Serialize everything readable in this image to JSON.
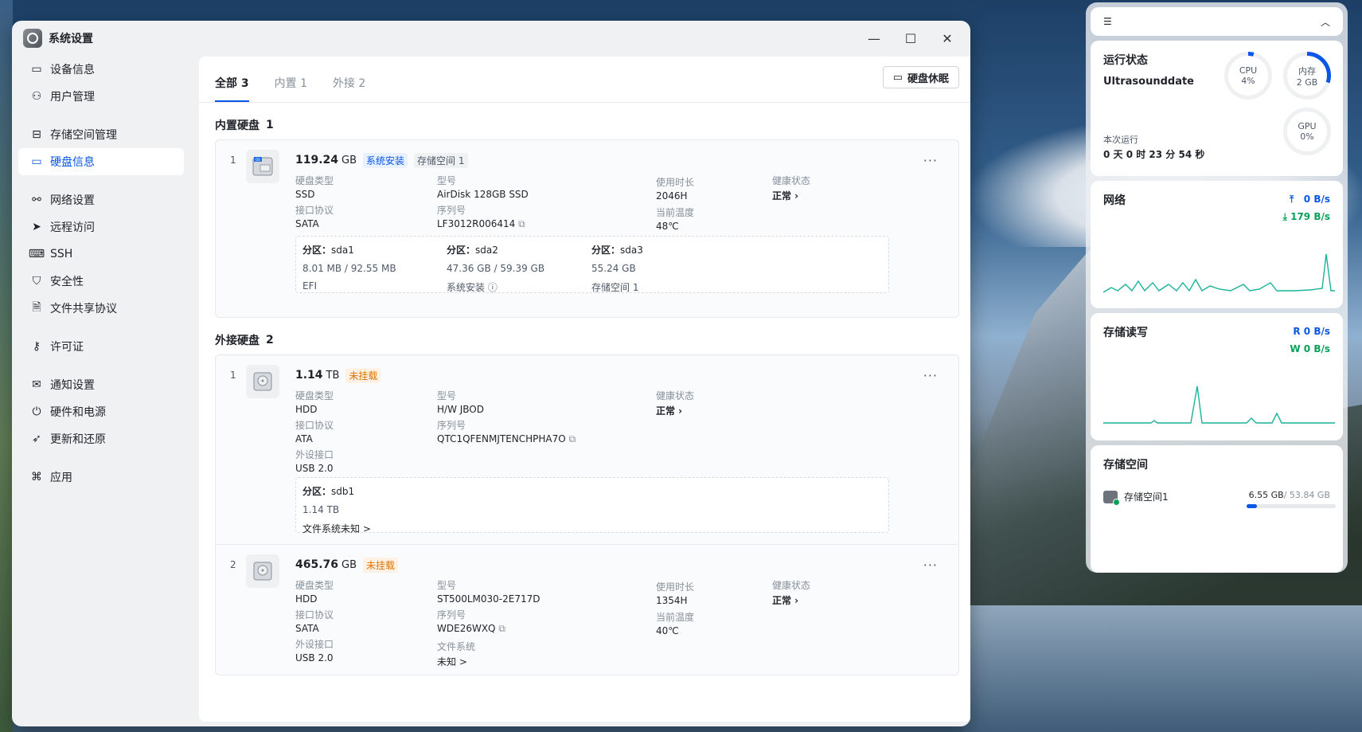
{
  "window": {
    "title": "系统设置"
  },
  "sidebar": {
    "items": [
      {
        "label": "设备信息",
        "icon": "device-icon"
      },
      {
        "label": "用户管理",
        "icon": "user-icon"
      },
      {
        "label": "存储空间管理",
        "icon": "storage-icon"
      },
      {
        "label": "硬盘信息",
        "icon": "disk-icon"
      },
      {
        "label": "网络设置",
        "icon": "network-icon"
      },
      {
        "label": "远程访问",
        "icon": "send-icon"
      },
      {
        "label": "SSH",
        "icon": "terminal-icon"
      },
      {
        "label": "安全性",
        "icon": "shield-icon"
      },
      {
        "label": "文件共享协议",
        "icon": "file-icon"
      },
      {
        "label": "许可证",
        "icon": "key-icon"
      },
      {
        "label": "通知设置",
        "icon": "mail-icon"
      },
      {
        "label": "硬件和电源",
        "icon": "power-icon"
      },
      {
        "label": "更新和还原",
        "icon": "rocket-icon"
      },
      {
        "label": "应用",
        "icon": "apps-icon"
      }
    ]
  },
  "tabs": [
    {
      "label": "全部 3"
    },
    {
      "label": "内置 1"
    },
    {
      "label": "外接 2"
    }
  ],
  "sleep_button": "硬盘休眠",
  "internal": {
    "title": "内置硬盘",
    "count": "1",
    "disk1": {
      "index": "1",
      "size": "119.24",
      "unit": "GB",
      "tag1": "系统安装",
      "tag2": "存储空间 1",
      "type_l": "硬盘类型",
      "type_v": "SSD",
      "model_l": "型号",
      "model_v": "AirDisk 128GB SSD",
      "uptime_l": "使用时长",
      "uptime_v": "2046H",
      "health_l": "健康状态",
      "health_v": "正常 ›",
      "proto_l": "接口协议",
      "proto_v": "SATA",
      "serial_l": "序列号",
      "serial_v": "LF3012R006414",
      "temp_l": "当前温度",
      "temp_v": "48℃",
      "parts": [
        {
          "name": "分区：",
          "id": "sda1",
          "size": "8.01 MB / 92.55 MB",
          "fs": "EFI"
        },
        {
          "name": "分区：",
          "id": "sda2",
          "size": "47.36 GB / 59.39 GB",
          "fs": "系统安装"
        },
        {
          "name": "分区：",
          "id": "sda3",
          "size": "55.24 GB",
          "fs": "存储空间 1"
        }
      ]
    }
  },
  "external": {
    "title": "外接硬盘",
    "count": "2",
    "disk1": {
      "index": "1",
      "size": "1.14",
      "unit": "TB",
      "tag": "未挂载",
      "type_l": "硬盘类型",
      "type_v": "HDD",
      "model_l": "型号",
      "model_v": "H/W JBOD",
      "health_l": "健康状态",
      "health_v": "正常 ›",
      "proto_l": "接口协议",
      "proto_v": "ATA",
      "serial_l": "序列号",
      "serial_v": "QTC1QFENMJTENCHPHA7O",
      "port_l": "外设接口",
      "port_v": "USB 2.0",
      "part": {
        "name": "分区：",
        "id": "sdb1",
        "size": "1.14 TB",
        "fs": "文件系统未知 >"
      }
    },
    "disk2": {
      "index": "2",
      "size": "465.76",
      "unit": "GB",
      "tag": "未挂载",
      "type_l": "硬盘类型",
      "type_v": "HDD",
      "model_l": "型号",
      "model_v": "ST500LM030-2E717D",
      "uptime_l": "使用时长",
      "uptime_v": "1354H",
      "health_l": "健康状态",
      "health_v": "正常 ›",
      "proto_l": "接口协议",
      "proto_v": "SATA",
      "serial_l": "序列号",
      "serial_v": "WDE26WXQ",
      "temp_l": "当前温度",
      "temp_v": "40℃",
      "port_l": "外设接口",
      "port_v": "USB 2.0",
      "fs_l": "文件系统",
      "fs_v": "未知 >"
    }
  },
  "widgets": {
    "status": {
      "title": "运行状态",
      "host": "Ultrasounddate",
      "cpu_label": "CPU",
      "cpu_value": "4%",
      "cpu_fraction": 0.04,
      "mem_label": "内存",
      "mem_value": "2 GB",
      "mem_fraction": 0.3,
      "gpu_label": "GPU",
      "gpu_value": "0%",
      "uptime_label": "本次运行",
      "uptime_value": "0 天 0 时 23 分 54 秒"
    },
    "network": {
      "title": "网络",
      "up": "0 B/s",
      "down": "179 B/s"
    },
    "disk_io": {
      "title": "存储读写",
      "read": "R 0 B/s",
      "write": "W 0 B/s"
    },
    "storage": {
      "title": "存储空间",
      "name": "存储空间1",
      "used": "6.55 GB",
      "total": "/ 53.84 GB",
      "fraction": 0.12
    },
    "colors": {
      "accent": "#0a56e8",
      "green": "#0aa05a",
      "chart": "#19b39a"
    }
  }
}
